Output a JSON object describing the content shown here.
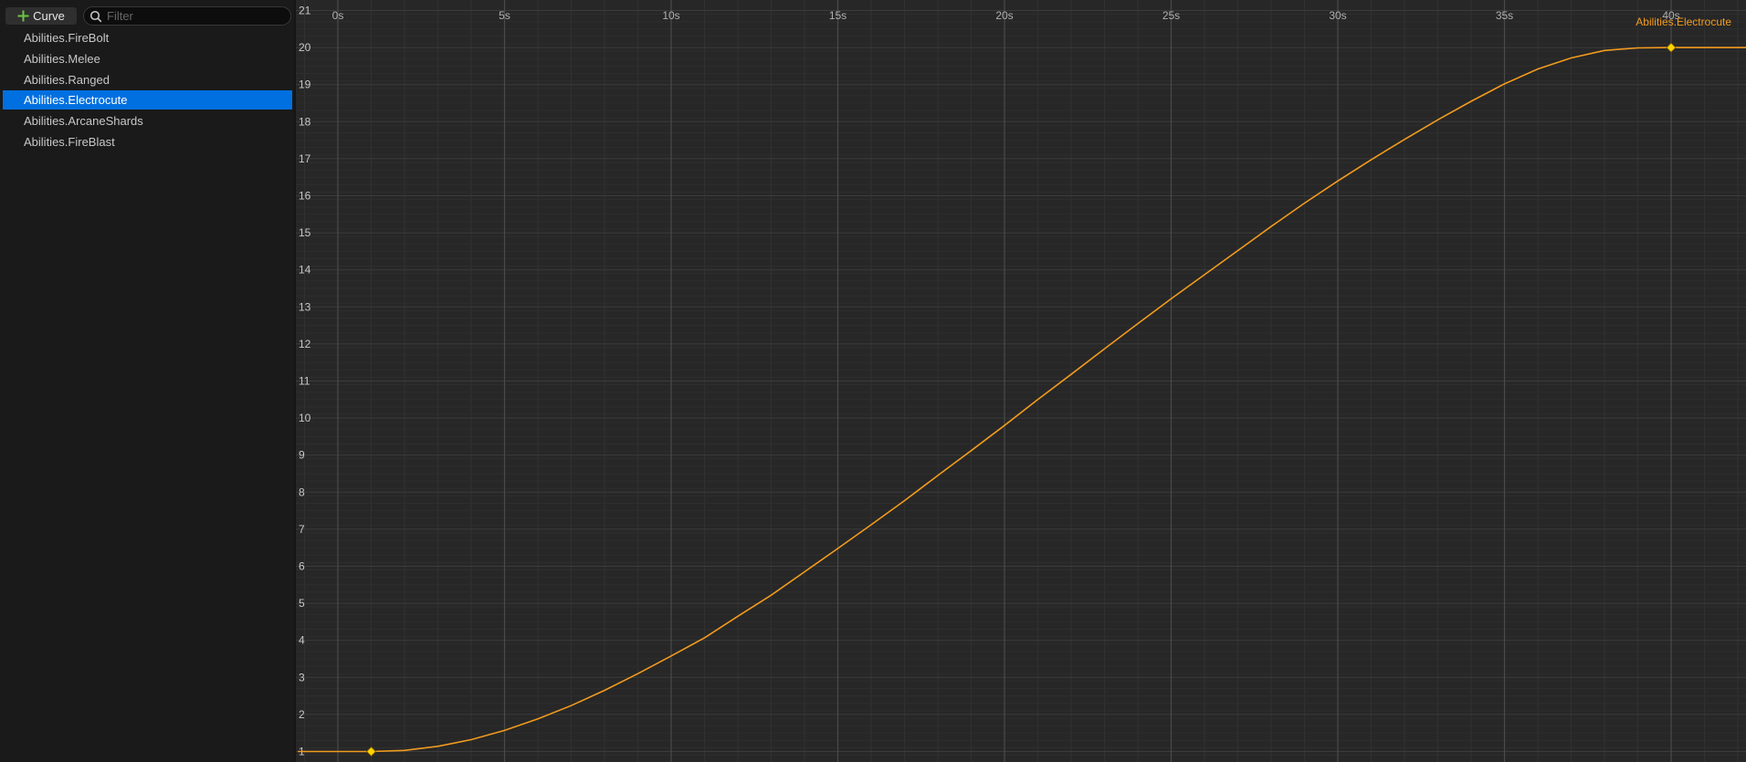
{
  "toolbar": {
    "add_curve_label": "Curve",
    "filter_placeholder": "Filter"
  },
  "curves": [
    {
      "label": "Abilities.FireBolt",
      "selected": false
    },
    {
      "label": "Abilities.Melee",
      "selected": false
    },
    {
      "label": "Abilities.Ranged",
      "selected": false
    },
    {
      "label": "Abilities.Electrocute",
      "selected": true
    },
    {
      "label": "Abilities.ArcaneShards",
      "selected": false
    },
    {
      "label": "Abilities.FireBlast",
      "selected": false
    }
  ],
  "colors": {
    "curve": "#f29b1e",
    "selection": "#0070e0",
    "key": "#ffd400"
  },
  "chart_data": {
    "type": "line",
    "title": "",
    "xlabel": "",
    "ylabel": "",
    "xlim": [
      -1.2,
      42.4
    ],
    "ylim": [
      0.7,
      21
    ],
    "x_ticks": [
      {
        "v": 0,
        "label": "0s"
      },
      {
        "v": 5,
        "label": "5s"
      },
      {
        "v": 10,
        "label": "10s"
      },
      {
        "v": 15,
        "label": "15s"
      },
      {
        "v": 20,
        "label": "20s"
      },
      {
        "v": 25,
        "label": "25s"
      },
      {
        "v": 30,
        "label": "30s"
      },
      {
        "v": 35,
        "label": "35s"
      },
      {
        "v": 40,
        "label": "40s"
      }
    ],
    "y_ticks": [
      1,
      2,
      3,
      4,
      5,
      6,
      7,
      8,
      9,
      10,
      11,
      12,
      13,
      14,
      15,
      16,
      17,
      18,
      19,
      20,
      21
    ],
    "grid": true,
    "series": [
      {
        "name": "Abilities.Electrocute",
        "keys": [
          {
            "x": 1,
            "y": 1
          },
          {
            "x": 40,
            "y": 20
          }
        ],
        "x": [
          -1.2,
          0,
          1,
          2,
          3,
          4,
          5,
          6,
          7,
          8,
          9,
          10,
          11,
          12,
          13,
          14,
          15,
          16,
          17,
          18,
          19,
          20,
          21,
          22,
          23,
          24,
          25,
          26,
          27,
          28,
          29,
          30,
          31,
          32,
          33,
          34,
          35,
          36,
          37,
          38,
          39,
          40,
          41,
          42.4
        ],
        "y": [
          1,
          1,
          1,
          1.03,
          1.14,
          1.32,
          1.57,
          1.88,
          2.24,
          2.65,
          3.1,
          3.58,
          4.07,
          4.65,
          5.22,
          5.85,
          6.48,
          7.12,
          7.77,
          8.45,
          9.12,
          9.8,
          10.5,
          11.18,
          11.87,
          12.55,
          13.22,
          13.87,
          14.52,
          15.17,
          15.8,
          16.4,
          16.97,
          17.52,
          18.05,
          18.55,
          19.02,
          19.42,
          19.72,
          19.92,
          19.99,
          20,
          20,
          20
        ]
      }
    ]
  }
}
